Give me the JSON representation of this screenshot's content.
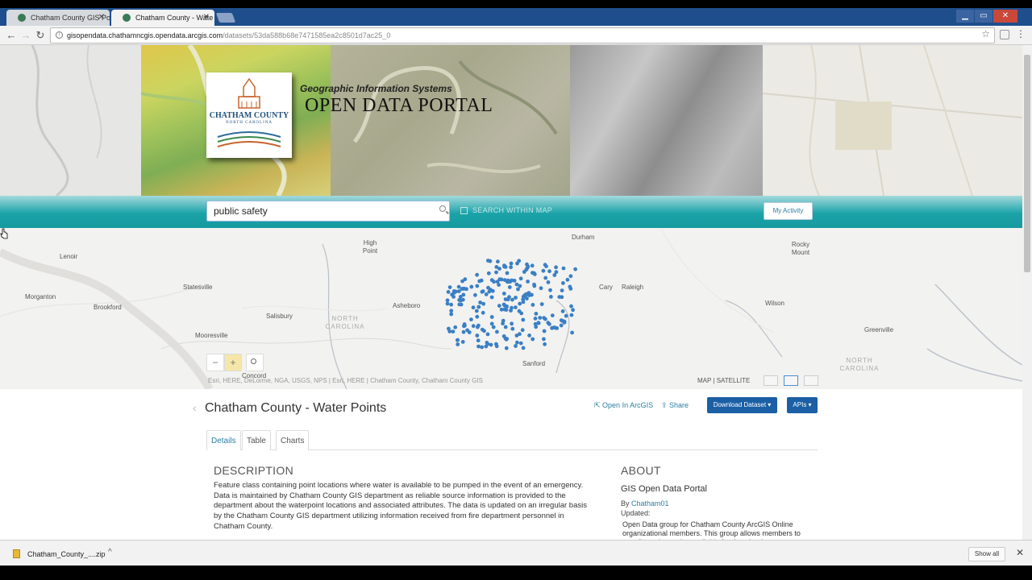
{
  "browser": {
    "tabs": [
      {
        "title": "Chatham County GIS Po",
        "active": false
      },
      {
        "title": "Chatham County - Wate",
        "active": true
      }
    ],
    "url_domain": "gisopendata.chathamncgis.opendata.arcgis.com",
    "url_path": "/datasets/53da588b68e7471585ea2c8501d7ac25_0"
  },
  "banner": {
    "logo_line1": "CHATHAM COUNTY",
    "logo_line2": "NORTH CAROLINA",
    "subtitle": "Geographic Information Systems",
    "title": "OPEN DATA PORTAL"
  },
  "search": {
    "value": "public safety",
    "within_map_label": "SEARCH WITHIN MAP",
    "activity_button": "My Activity"
  },
  "map": {
    "labels": {
      "lenoir": "Lenoir",
      "high_point": "High Point",
      "durham": "Durham",
      "rocky_mount": "Rocky Mount",
      "statesville": "Statesville",
      "cary": "Cary",
      "raleigh": "Raleigh",
      "morganton": "Morganton",
      "brookford": "Brookford",
      "asheboro": "Asheboro",
      "salisbury": "Salisbury",
      "north_carolina_1": "NORTH CAROLINA",
      "wilson": "Wilson",
      "mooresville": "Mooresville",
      "greenville": "Greenville",
      "sanford": "Sanford",
      "north_carolina_2": "NORTH CAROLINA",
      "concord": "Concord"
    },
    "zoom_out": "−",
    "zoom_in": "+",
    "attribution": "Esri, HERE, DeLorme, NGA, USGS, NPS | Esri, HERE | Chatham County, Chatham County GIS",
    "map_type": "MAP | SATELLITE",
    "point_color": "#3b7fc4"
  },
  "dataset": {
    "title": "Chatham County - Water Points",
    "open_in_arcgis": "Open In ArcGIS",
    "share": "Share",
    "download": "Download Dataset ▾",
    "apis": "APIs ▾",
    "tabs": [
      "Details",
      "Table",
      "Charts"
    ],
    "description_heading": "DESCRIPTION",
    "description": "Feature class containing point locations where water is available to be pumped in the event of an emergency. Data is maintained by Chatham County GIS department as reliable source information is provided to the department about the waterpoint locations and associated attributes. The data is updated on an irregular basis by the Chatham County GIS department utilizing information received from fire department personnel in Chatham County.",
    "about_heading": "ABOUT",
    "about_subtitle": "GIS Open Data Portal",
    "by_label": "By",
    "by_user": "Chatham01",
    "updated_label": "Updated:",
    "about_desc": "Open Data group for Chatham County ArcGIS Online organizational members.  This group allows members to contribute data to be available for download"
  },
  "downloads": {
    "file": "Chatham_County_....zip",
    "show_all": "Show all"
  }
}
